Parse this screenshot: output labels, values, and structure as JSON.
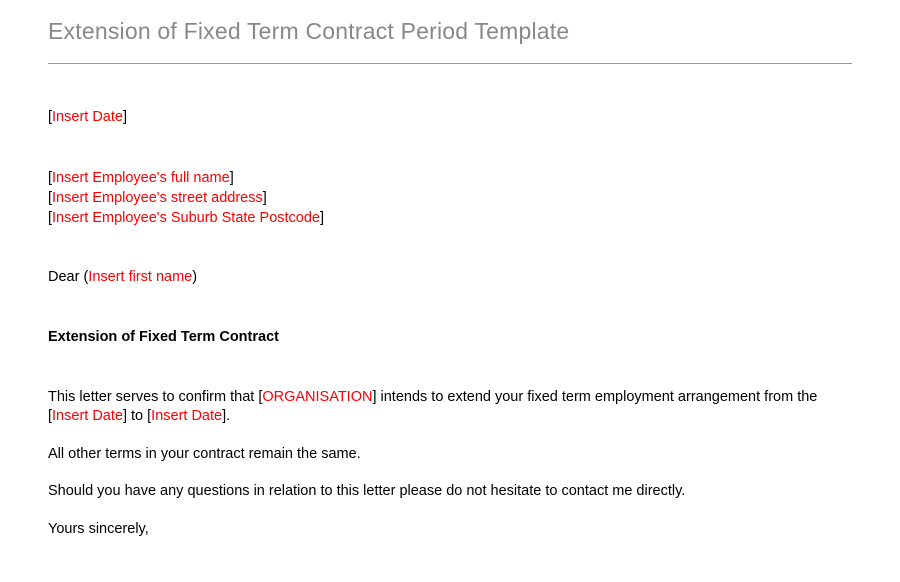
{
  "title": "Extension of Fixed Term Contract Period Template",
  "date": {
    "open": "[",
    "ph": "Insert Date",
    "close": "]"
  },
  "addr": {
    "line1": {
      "open": "[",
      "ph": "Insert Employee's full name",
      "close": "]"
    },
    "line2": {
      "open": "[",
      "ph": "Insert Employee's street address",
      "close": "]"
    },
    "line3": {
      "open": "[",
      "ph": "Insert Employee's Suburb State Postcode",
      "close": "]"
    }
  },
  "salutation": {
    "dear": "Dear (",
    "ph": "Insert first name",
    "close": ")"
  },
  "subject": "Extension  of Fixed Term Contract",
  "body": {
    "p1_a": "This letter serves to confirm that [",
    "p1_org": "ORGANISATION",
    "p1_b": "]  intends to extend your fixed term employment arrangement  from the [",
    "p1_d1": "Insert Date",
    "p1_c": "] to [",
    "p1_d2": "Insert Date",
    "p1_d": "].",
    "p2": "All other terms in your contract remain the same.",
    "p3": "Should you have any questions in relation to this letter please do not hesitate to contact me directly.",
    "p4": "Yours sincerely,"
  }
}
